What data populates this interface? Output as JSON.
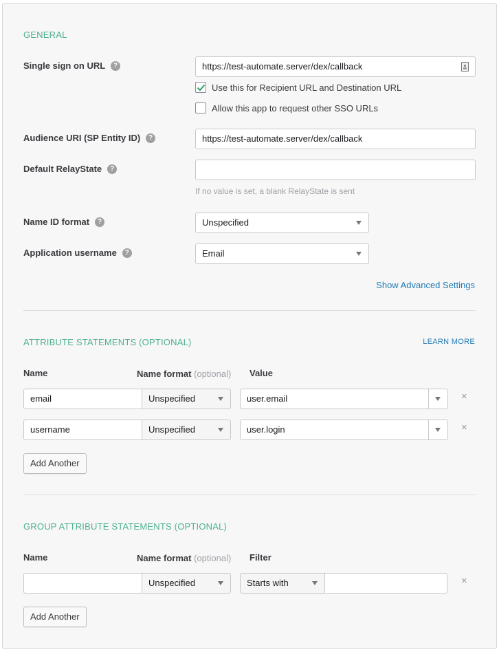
{
  "general": {
    "section_title": "GENERAL",
    "single_sign_on_url": {
      "label": "Single sign on URL",
      "value": "https://test-automate.server/dex/callback",
      "recipient_checkbox": {
        "label": "Use this for Recipient URL and Destination URL",
        "checked": true
      },
      "other_sso_checkbox": {
        "label": "Allow this app to request other SSO URLs",
        "checked": false
      }
    },
    "audience_uri": {
      "label": "Audience URI (SP Entity ID)",
      "value": "https://test-automate.server/dex/callback"
    },
    "default_relay_state": {
      "label": "Default RelayState",
      "value": "",
      "hint": "If no value is set, a blank RelayState is sent"
    },
    "name_id_format": {
      "label": "Name ID format",
      "value": "Unspecified"
    },
    "application_username": {
      "label": "Application username",
      "value": "Email"
    },
    "advanced_link": "Show Advanced Settings",
    "help_glyph": "?"
  },
  "attribute_statements": {
    "section_title": "ATTRIBUTE STATEMENTS (OPTIONAL)",
    "learn_more": "LEARN MORE",
    "columns": {
      "name": "Name",
      "name_format": "Name format",
      "optional": "(optional)",
      "value": "Value"
    },
    "rows": [
      {
        "name": "email",
        "name_format": "Unspecified",
        "value": "user.email"
      },
      {
        "name": "username",
        "name_format": "Unspecified",
        "value": "user.login"
      }
    ],
    "add_button": "Add Another",
    "remove_glyph": "×"
  },
  "group_attribute_statements": {
    "section_title": "GROUP ATTRIBUTE STATEMENTS (OPTIONAL)",
    "columns": {
      "name": "Name",
      "name_format": "Name format",
      "optional": "(optional)",
      "filter": "Filter"
    },
    "rows": [
      {
        "name": "",
        "name_format": "Unspecified",
        "filter_type": "Starts with",
        "filter_value": ""
      }
    ],
    "add_button": "Add Another",
    "remove_glyph": "×"
  },
  "colors": {
    "section_accent": "#4cb28c",
    "link": "#1f7ab8",
    "checkmark": "#2e9e6b"
  }
}
